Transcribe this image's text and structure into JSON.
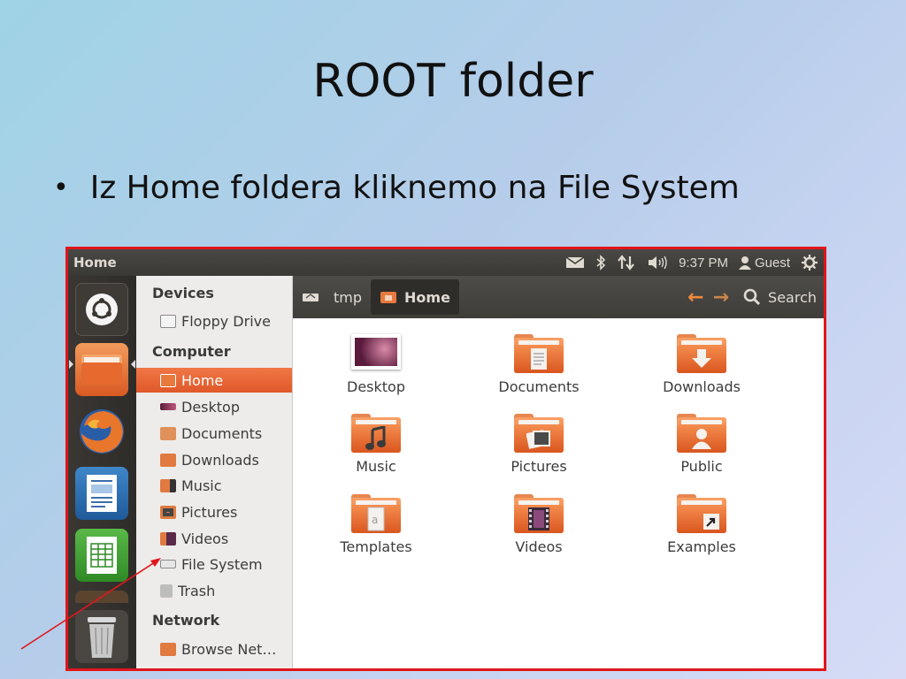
{
  "slide": {
    "title": "ROOT folder",
    "bullet": "Iz Home foldera kliknemo na File System"
  },
  "topbar": {
    "window_title": "Home",
    "time": "9:37 PM",
    "user": "Guest"
  },
  "launcher": {
    "items": [
      "dash-icon",
      "files-icon",
      "firefox-icon",
      "writer-icon",
      "calc-icon",
      "trash-icon"
    ]
  },
  "sidebar": {
    "devices_header": "Devices",
    "floppy": "Floppy Drive",
    "computer_header": "Computer",
    "home": "Home",
    "desktop": "Desktop",
    "documents": "Documents",
    "downloads": "Downloads",
    "music": "Music",
    "pictures": "Pictures",
    "videos": "Videos",
    "filesystem": "File System",
    "trash": "Trash",
    "network_header": "Network",
    "browse": "Browse Net…"
  },
  "toolbar": {
    "crumb_tmp": "tmp",
    "crumb_home": "Home",
    "search": "Search"
  },
  "content": {
    "items": [
      "Desktop",
      "Documents",
      "Downloads",
      "Music",
      "Pictures",
      "Public",
      "Templates",
      "Videos",
      "Examples"
    ]
  },
  "colors": {
    "accent": "#e8642c",
    "annotation": "#e0161b"
  }
}
